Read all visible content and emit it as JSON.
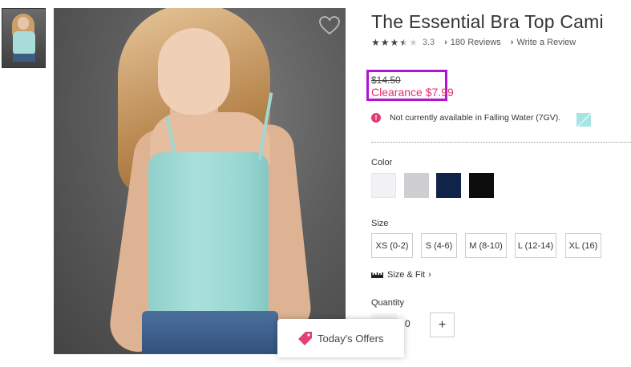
{
  "product": {
    "title": "The Essential Bra Top Cami",
    "rating": 3.3,
    "rating_text": "3.3",
    "reviews_link": "180 Reviews",
    "write_review_link": "Write a Review",
    "old_price": "$14.50",
    "clearance_price": "Clearance $7.99",
    "availability_message": "Not currently available in Falling Water (7GV)."
  },
  "color": {
    "label": "Color",
    "swatches": [
      "#f2f2f4",
      "#cfcfd1",
      "#10244a",
      "#0d0d0d"
    ],
    "unavailable_swatch": "#a7e4e6"
  },
  "size": {
    "label": "Size",
    "options": [
      "XS (0-2)",
      "S (4-6)",
      "M (8-10)",
      "L (12-14)",
      "XL (16)"
    ],
    "size_fit_link": "Size & Fit"
  },
  "quantity": {
    "label": "Quantity",
    "value": "0",
    "plus": "+"
  },
  "offers": {
    "label": "Today's Offers"
  },
  "colors": {
    "accent_pink": "#e3316d",
    "highlight_box": "#b113d7"
  },
  "icons": {
    "wishlist": "heart-icon",
    "alert": "alert-icon",
    "ruler": "ruler-icon",
    "offers": "tag-icon"
  }
}
